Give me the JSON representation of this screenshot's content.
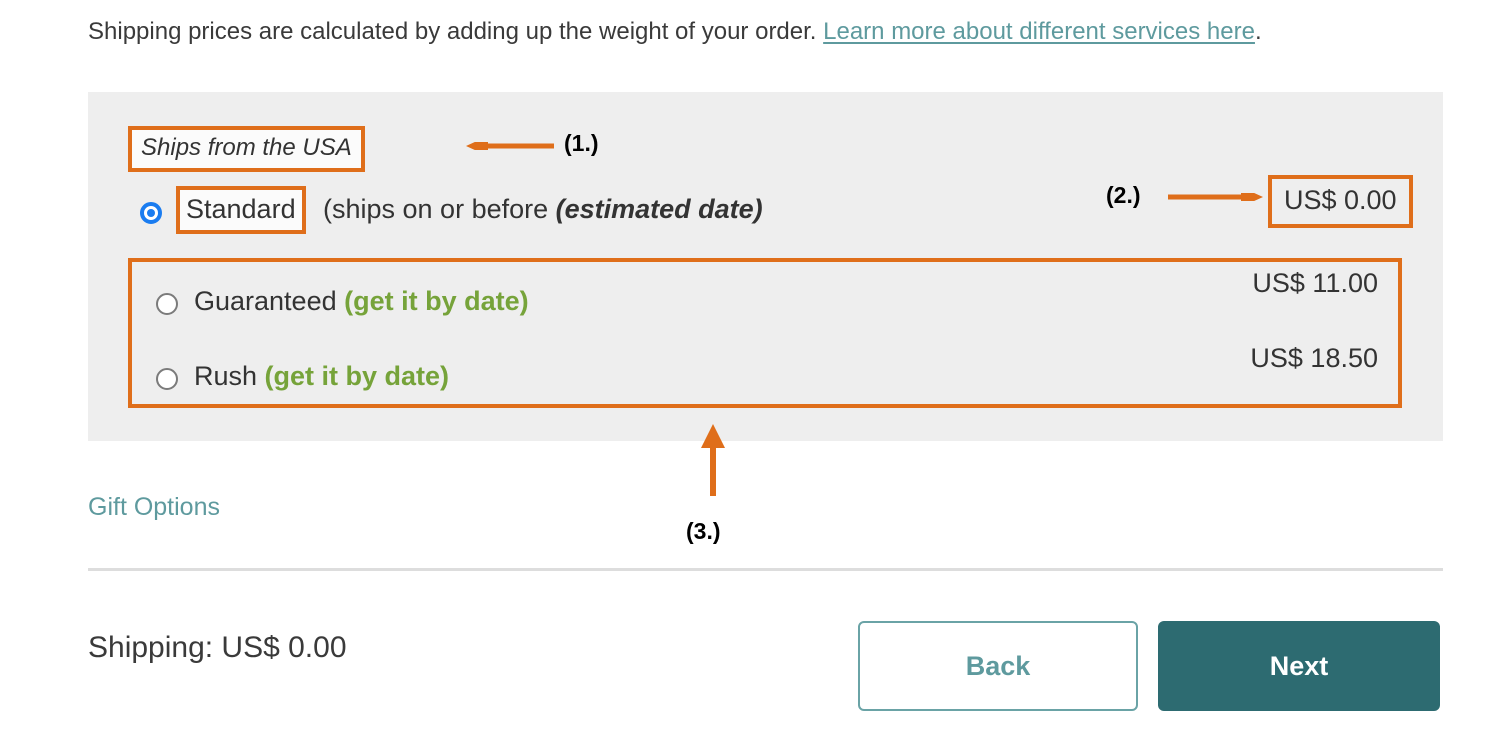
{
  "intro": {
    "text_before": "Shipping prices are calculated by adding up the weight of your order. ",
    "link_text": "Learn more about different services here",
    "text_after": "."
  },
  "panel": {
    "ships_from": "Ships from the USA",
    "standard": {
      "label": "Standard",
      "description_before": "(ships on or before ",
      "description_emphasis": "(estimated date)",
      "price": "US$ 0.00",
      "selected": true
    },
    "options": [
      {
        "label": "Guaranteed",
        "eta": "(get it by date)",
        "price": "US$ 11.00",
        "selected": false
      },
      {
        "label": "Rush",
        "eta": "(get it by date)",
        "price": "US$ 18.50",
        "selected": false
      }
    ]
  },
  "annotations": {
    "one": "(1.)",
    "two": "(2.)",
    "three": "(3.)"
  },
  "gift_options_label": "Gift Options",
  "footer": {
    "shipping_total": "Shipping: US$ 0.00",
    "back_label": "Back",
    "next_label": "Next"
  },
  "colors": {
    "annotation_orange": "#df6e1a",
    "teal_link": "#5e9a9e",
    "next_button": "#2d6b71",
    "eta_green": "#76a33a",
    "panel_gray": "#eeeeee",
    "radio_blue": "#1a7cf0"
  }
}
